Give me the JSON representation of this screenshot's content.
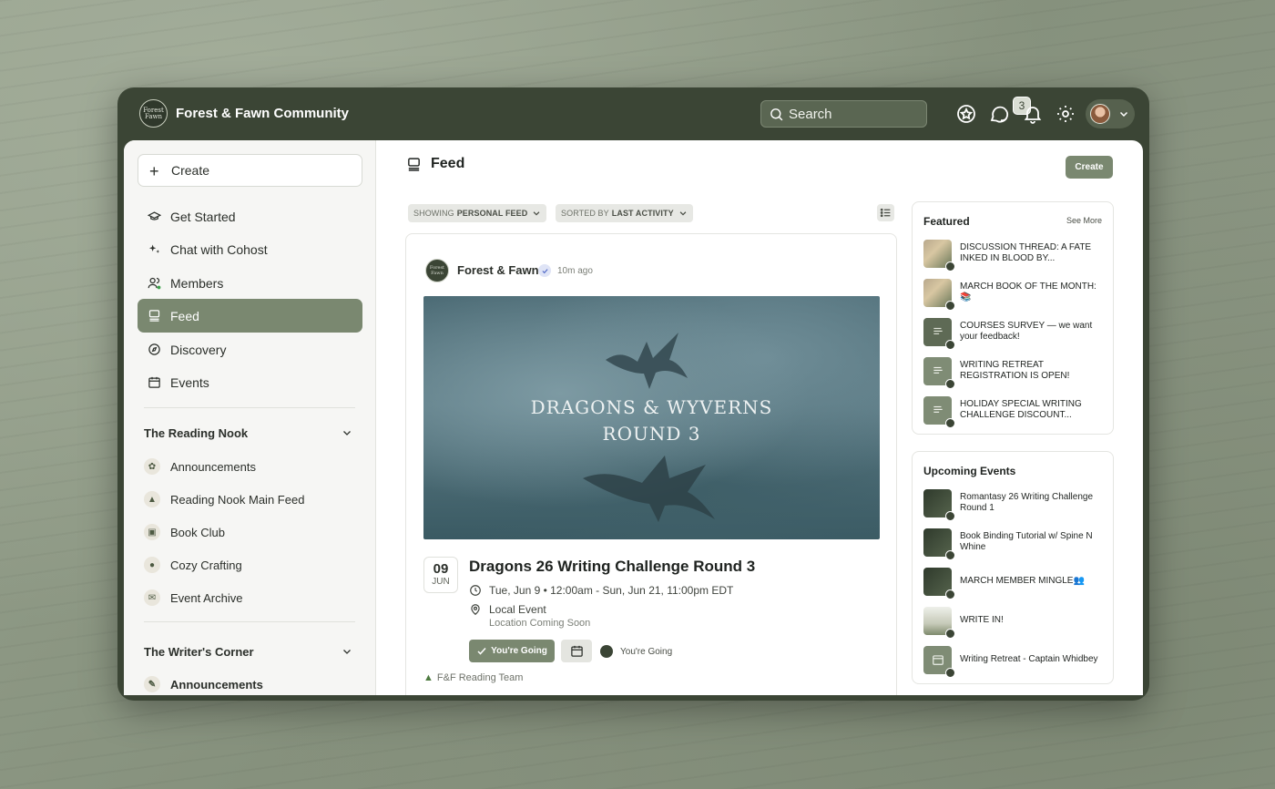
{
  "brand": {
    "name": "Forest & Fawn Community",
    "logo_text": "Forest Fawn"
  },
  "topbar": {
    "search_placeholder": "Search",
    "notifications_count": "3"
  },
  "sidebar": {
    "create_label": "Create",
    "nav": [
      {
        "label": "Get Started"
      },
      {
        "label": "Chat with Cohost"
      },
      {
        "label": "Members"
      },
      {
        "label": "Feed"
      },
      {
        "label": "Discovery"
      },
      {
        "label": "Events"
      }
    ],
    "sections": [
      {
        "title": "The Reading Nook",
        "items": [
          {
            "label": "Announcements"
          },
          {
            "label": "Reading Nook Main Feed"
          },
          {
            "label": "Book Club"
          },
          {
            "label": "Cozy Crafting"
          },
          {
            "label": "Event Archive"
          }
        ]
      },
      {
        "title": "The Writer's Corner",
        "items": [
          {
            "label": "Announcements"
          }
        ]
      }
    ]
  },
  "main": {
    "title": "Feed",
    "create_label": "Create",
    "filter_showing_prefix": "SHOWING",
    "filter_showing_value": "PERSONAL FEED",
    "filter_sorted_prefix": "SORTED BY",
    "filter_sorted_value": "LAST ACTIVITY"
  },
  "post": {
    "author": "Forest & Fawn",
    "time": "10m ago",
    "banner_line1": "DRAGONS & WYVERNS",
    "banner_line2": "ROUND 3",
    "date_day": "09",
    "date_month": "JUN",
    "event_title": "Dragons 26 Writing Challenge Round 3",
    "event_time": "Tue, Jun 9 • 12:00am - Sun, Jun 21, 11:00pm EDT",
    "location": "Local Event",
    "location_sub": "Location Coming Soon",
    "going_button": "You're Going",
    "going_indicator": "You're Going",
    "space_tag": "F&F Reading Team"
  },
  "featured": {
    "title": "Featured",
    "see_more": "See More",
    "items": [
      {
        "label": "DISCUSSION THREAD: A FATE INKED IN BLOOD BY..."
      },
      {
        "label": "MARCH BOOK OF THE MONTH: 📚"
      },
      {
        "label": "COURSES SURVEY — we want your feedback!"
      },
      {
        "label": "WRITING RETREAT REGISTRATION IS OPEN!"
      },
      {
        "label": "HOLIDAY SPECIAL WRITING CHALLENGE DISCOUNT..."
      }
    ]
  },
  "upcoming": {
    "title": "Upcoming Events",
    "items": [
      {
        "label": "Romantasy 26 Writing Challenge Round 1"
      },
      {
        "label": "Book Binding Tutorial w/ Spine N Whine"
      },
      {
        "label": "MARCH MEMBER MINGLE👥"
      },
      {
        "label": "WRITE IN!"
      },
      {
        "label": "Writing Retreat - Captain Whidbey"
      }
    ]
  }
}
